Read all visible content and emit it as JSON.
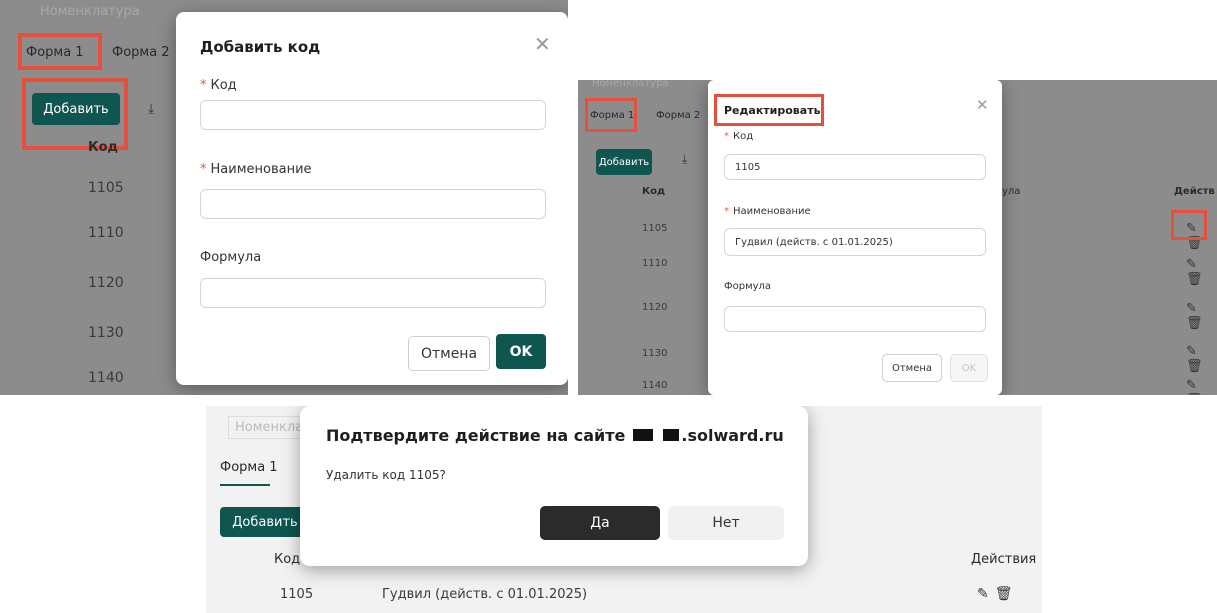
{
  "panel1": {
    "bg_field": "Номенклатура",
    "tabs": [
      "Форма 1",
      "Форма 2"
    ],
    "add_label": "Добавить",
    "download_icon": "download-icon",
    "column_code_partial": "Код",
    "codes": [
      "1105",
      "1110",
      "1120",
      "1130",
      "1140"
    ],
    "dialog": {
      "title": "Добавить код",
      "close_icon": "close-icon",
      "code_label": "Код",
      "name_label": "Наименование",
      "formula_label": "Формула",
      "code_value": "",
      "name_value": "",
      "formula_value": "",
      "cancel": "Отмена",
      "ok": "OK"
    }
  },
  "panel2": {
    "bg_field": "Номенклатура",
    "tabs": [
      "Форма 1",
      "Форма 2"
    ],
    "add_label": "Добавить",
    "column_code": "Код",
    "column_formula_partial": "ула",
    "column_actions_partial": "Действ",
    "codes": [
      "1105",
      "1110",
      "1120",
      "1130",
      "1140"
    ],
    "dialog": {
      "title": "Редактировать",
      "code_label": "Код",
      "code_value": "1105",
      "name_label": "Наименование",
      "name_value": "Гудвил (действ. с 01.01.2025)",
      "formula_label": "Формула",
      "formula_value": "",
      "cancel": "Отмена",
      "ok": "OK"
    }
  },
  "panel3": {
    "bg_field": "Номенклату",
    "tab": "Форма 1",
    "add_label": "Добавить",
    "column_code": "Код",
    "column_actions": "Действия",
    "row": {
      "code": "1105",
      "name": "Гудвил (действ. с 01.01.2025)"
    },
    "dialog": {
      "title_prefix": "Подтвердите действие на сайте",
      "title_domain": ".solward.ru",
      "message": "Удалить код 1105?",
      "yes": "Да",
      "no": "Нет"
    }
  },
  "colors": {
    "accent_green": "#0f5550",
    "highlight_red": "#e4503c",
    "dark_button": "#2b2b2b"
  }
}
